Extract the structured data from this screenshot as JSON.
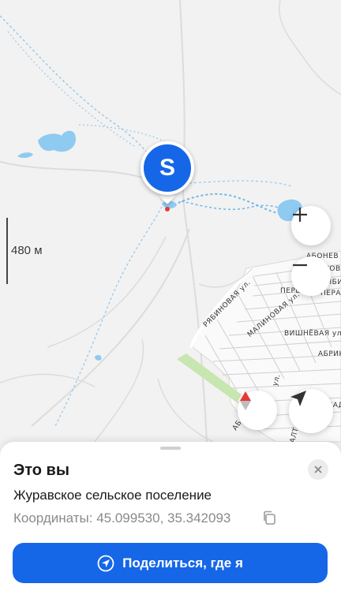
{
  "map": {
    "scale_label": "480 м",
    "streets": {
      "aboneva": "АБОНЕВ",
      "vlasova": "ВЛАСОВА",
      "ryabi": "РЯБИ",
      "pereulok": "ПЕРЕУЛОК",
      "pera": "ПЕРА",
      "ryabinovaya": "РЯБИНОВАЯ ул.",
      "malinovaya": "МАЛИНОВАЯ ул.",
      "vishnevaya": "ВИШНЁВАЯ ул.",
      "abrik": "АБРИК",
      "abu": "АБ",
      "ul_vert": "ул.",
      "sad": "САД",
      "alt": "АЛТ"
    },
    "pin_letter": "S"
  },
  "controls": {
    "zoom_in": "+",
    "zoom_out": "−"
  },
  "sheet": {
    "title": "Это вы",
    "locality": "Журавское сельское поселение",
    "coordinates": "Координаты: 45.099530, 35.342093",
    "share_label": "Поделиться, где я"
  },
  "colors": {
    "accent": "#1666e8",
    "water": "#8fcaf0",
    "park": "#c8e6b0"
  }
}
